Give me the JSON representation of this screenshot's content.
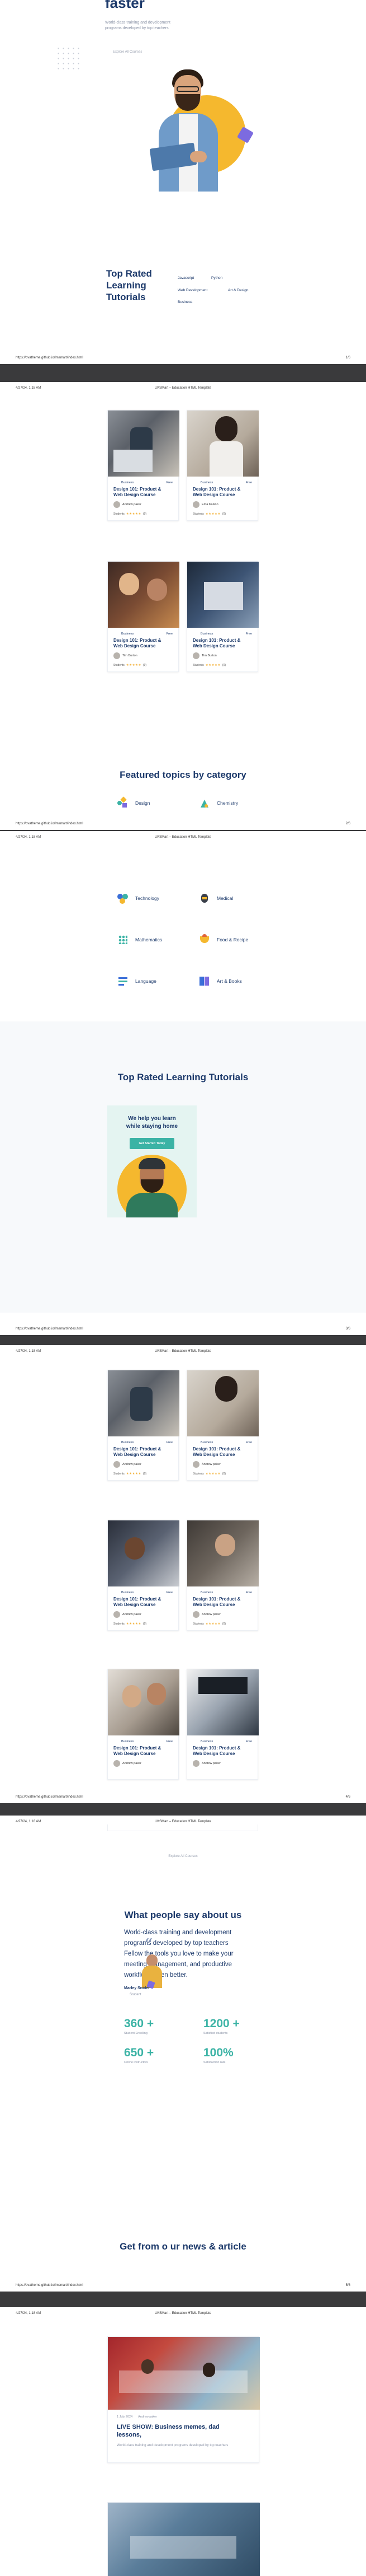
{
  "header": {
    "datetime": "4/27/24, 1:18 AM",
    "title": "LMSMart – Education HTML Template"
  },
  "footer": {
    "url": "https://ovatheme.github.io/lmsmart/index.html"
  },
  "pages": [
    {
      "number": "1/6"
    },
    {
      "number": "2/6"
    },
    {
      "number": "3/6"
    },
    {
      "number": "4/6"
    },
    {
      "number": "5/6"
    }
  ],
  "hero": {
    "title_tail": "faster",
    "subtitle": "World-class training and development programs developed by top teachers",
    "explore": "Explore All Courses"
  },
  "top_rated": {
    "heading": "Top Rated Learning Tutorials",
    "heading_lines": [
      "Top Rated",
      "Learning",
      "Tutorials"
    ],
    "tags": [
      "Javascript",
      "Python",
      "Web Development",
      "Art & Design",
      "Business"
    ]
  },
  "course_common": {
    "category": "Business",
    "price": "Free",
    "title_line1": "Design 101: Product &",
    "title_line2": "Web Design Course",
    "students": "Students",
    "stars": "★★★★★",
    "rating": "(0)"
  },
  "authors": {
    "andrew": "Andrew paker",
    "ema": "Ema Kalson",
    "tim": "Tim Burton"
  },
  "featured": {
    "heading": "Featured topics by category",
    "topics": [
      "Design",
      "Chemistry",
      "Technology",
      "Medical",
      "Mathematics",
      "Food & Recipe",
      "Language",
      "Art & Books"
    ]
  },
  "promo": {
    "line1": "We help you learn",
    "line2": "while staying home",
    "button": "Get Started Today"
  },
  "testimonials": {
    "heading": "What people say about us",
    "quote_lines": [
      "World-class training and development",
      "programs developed by top teachers",
      "Fellow the tools you love to make your",
      "meeting management, and productive",
      "workflows even better."
    ],
    "name": "Marley Snider",
    "role": "Student"
  },
  "stats": [
    {
      "value": "360 +",
      "label": "Student Enrolling"
    },
    {
      "value": "1200 +",
      "label": "Satisfied students"
    },
    {
      "value": "650 +",
      "label": "Online instructors"
    },
    {
      "value": "100%",
      "label": "Satisfaction rate"
    }
  ],
  "news": {
    "heading": "Get from o ur news & article",
    "date": "1 July 2024",
    "author": "Andrew paker",
    "title_line1": "LIVE SHOW: Business memes, dad",
    "title_line2": "lessons,",
    "excerpt": "World-class training and development programs developed by top teachers"
  },
  "colors": {
    "navy": "#1d3a6b",
    "teal": "#3bb3a5",
    "yellow": "#f5b82e",
    "purple": "#7c6be0"
  },
  "icons": [
    "book-icon",
    "design-icon",
    "chemistry-icon",
    "technology-icon",
    "medical-icon",
    "mathematics-icon",
    "food-icon",
    "language-icon",
    "art-books-icon",
    "quote-icon",
    "avatar-icon"
  ]
}
